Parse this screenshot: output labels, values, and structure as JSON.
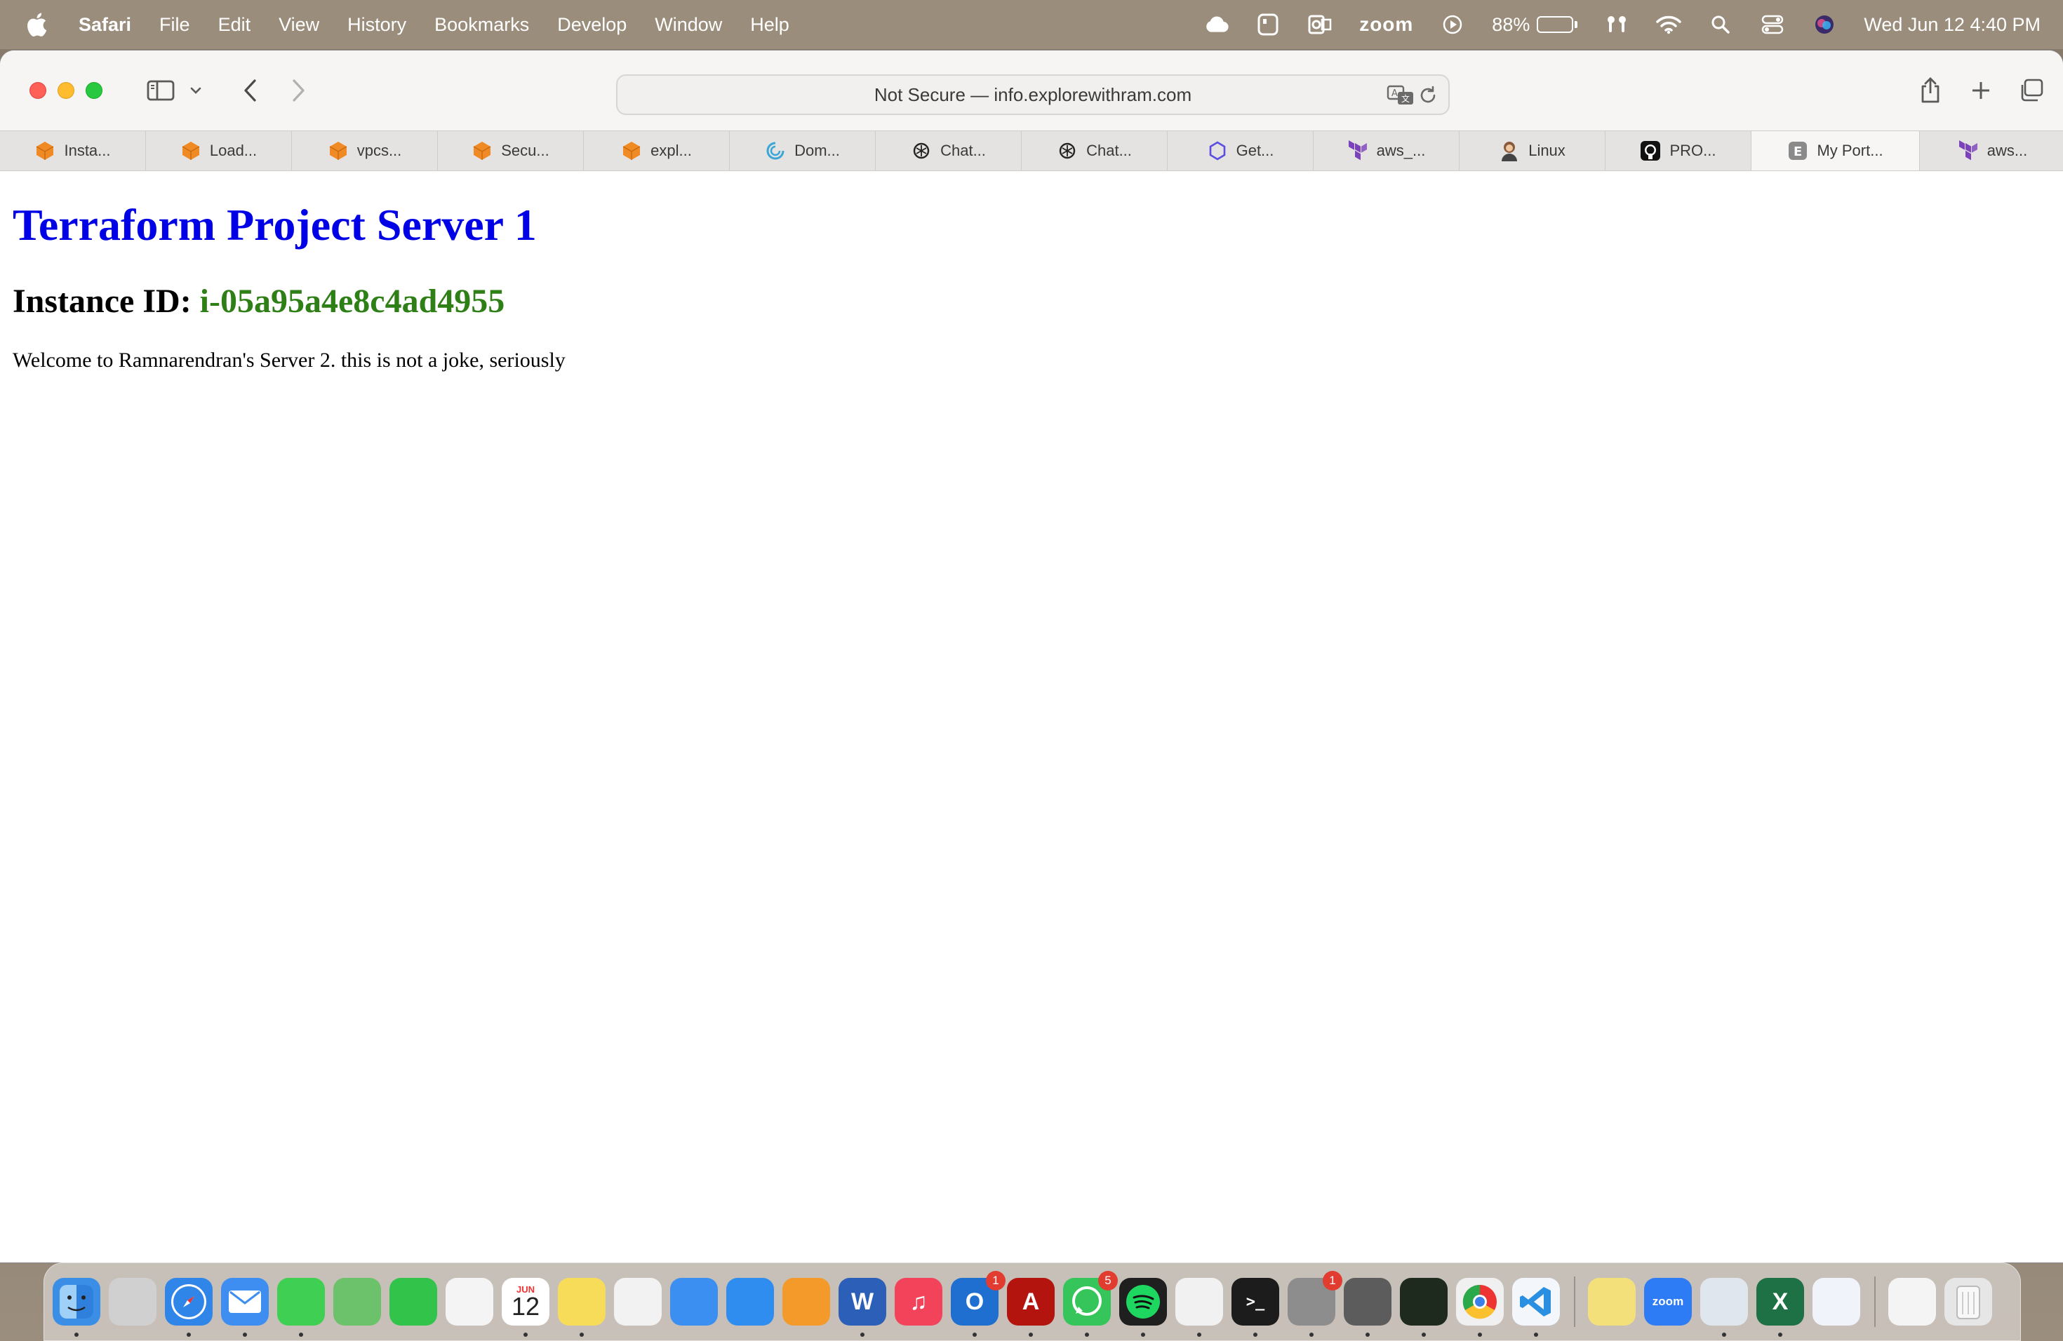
{
  "menubar": {
    "app_name": "Safari",
    "menus": [
      "File",
      "Edit",
      "View",
      "History",
      "Bookmarks",
      "Develop",
      "Window",
      "Help"
    ],
    "status": {
      "zoom_label": "zoom",
      "battery_percent": "88%",
      "battery_level": 0.88,
      "datetime": "Wed Jun 12  4:40 PM"
    }
  },
  "browser": {
    "address": {
      "text": "Not Secure — info.explorewithram.com"
    },
    "tabs": [
      {
        "label": "Insta...",
        "icon": "aws-cube-icon",
        "color": "#f08a24"
      },
      {
        "label": "Load...",
        "icon": "aws-cube-icon",
        "color": "#f08a24"
      },
      {
        "label": "vpcs...",
        "icon": "aws-cube-icon",
        "color": "#f08a24"
      },
      {
        "label": "Secu...",
        "icon": "aws-cube-icon",
        "color": "#f08a24"
      },
      {
        "label": "expl...",
        "icon": "aws-cube-icon",
        "color": "#f08a24"
      },
      {
        "label": "Dom...",
        "icon": "swirl-icon",
        "color": "#3aa6d8"
      },
      {
        "label": "Chat...",
        "icon": "chatgpt-icon",
        "color": "#222222"
      },
      {
        "label": "Chat...",
        "icon": "chatgpt-icon",
        "color": "#222222"
      },
      {
        "label": "Get...",
        "icon": "hexagon-icon",
        "color": "#5a4fe0"
      },
      {
        "label": "aws_...",
        "icon": "terraform-icon",
        "color": "#7b42bc"
      },
      {
        "label": "Linux",
        "icon": "avatar-icon",
        "color": "#8a5a3a"
      },
      {
        "label": "PRO...",
        "icon": "github-icon",
        "color": "#111111"
      },
      {
        "label": "My Port...",
        "icon": "letter-e-icon",
        "color": "#8a8a8a"
      },
      {
        "label": "aws...",
        "icon": "terraform-icon",
        "color": "#7b42bc"
      }
    ],
    "active_tab_index": 12
  },
  "page": {
    "heading": "Terraform Project Server 1",
    "instance_label": "Instance ID: ",
    "instance_id": "i-05a95a4e8c4ad4955",
    "message": "Welcome to Ramnarendran's Server 2. this is not a joke, seriously"
  },
  "dock": {
    "apps": [
      {
        "name": "finder",
        "color": "#3a8ee6",
        "badge": ""
      },
      {
        "name": "launchpad",
        "color": "#d0d0d0",
        "badge": ""
      },
      {
        "name": "safari",
        "color": "#2f86e8",
        "badge": ""
      },
      {
        "name": "mail",
        "color": "#3d8ef0",
        "badge": ""
      },
      {
        "name": "messages",
        "color": "#3fcf52",
        "badge": ""
      },
      {
        "name": "maps",
        "color": "#6cc26a",
        "badge": ""
      },
      {
        "name": "facetime",
        "color": "#32c34a",
        "badge": ""
      },
      {
        "name": "photos",
        "color": "#f4f4f4",
        "badge": ""
      },
      {
        "name": "calendar",
        "color": "#ffffff",
        "badge": ""
      },
      {
        "name": "notes",
        "color": "#f7dc5a",
        "badge": ""
      },
      {
        "name": "news",
        "color": "#f2f2f2",
        "badge": ""
      },
      {
        "name": "keynote",
        "color": "#3b8ff0",
        "badge": ""
      },
      {
        "name": "app-store",
        "color": "#2f8df0",
        "badge": ""
      },
      {
        "name": "pages",
        "color": "#f49a2a",
        "badge": ""
      },
      {
        "name": "word",
        "color": "#2b5fb8",
        "badge": ""
      },
      {
        "name": "music",
        "color": "#f3435a",
        "badge": ""
      },
      {
        "name": "outlook",
        "color": "#1f6fd1",
        "badge": "1"
      },
      {
        "name": "acrobat",
        "color": "#b3140d",
        "badge": ""
      },
      {
        "name": "whatsapp",
        "color": "#35c55a",
        "badge": "5"
      },
      {
        "name": "spotify",
        "color": "#1f1f1f",
        "badge": ""
      },
      {
        "name": "brave",
        "color": "#f1f1f1",
        "badge": ""
      },
      {
        "name": "terminal",
        "color": "#1c1c1c",
        "badge": ""
      },
      {
        "name": "system-settings",
        "color": "#8d8d8d",
        "badge": "1"
      },
      {
        "name": "calculator",
        "color": "#5c5c5c",
        "badge": ""
      },
      {
        "name": "activity-monitor",
        "color": "#1f2a1f",
        "badge": ""
      },
      {
        "name": "chrome",
        "color": "#f0f0f0",
        "badge": ""
      },
      {
        "name": "vscode",
        "color": "#f3f6fa",
        "badge": ""
      },
      {
        "name": "stickies",
        "color": "#f4e07a",
        "badge": ""
      },
      {
        "name": "zoom",
        "color": "#2d7cf6",
        "badge": ""
      },
      {
        "name": "preview",
        "color": "#dfe6ee",
        "badge": ""
      },
      {
        "name": "excel",
        "color": "#1e7145",
        "badge": ""
      },
      {
        "name": "onedrive",
        "color": "#f0f4fa",
        "badge": ""
      },
      {
        "name": "downloads-stack",
        "color": "#f4f4f4",
        "badge": ""
      },
      {
        "name": "trash",
        "color": "#e6e6e6",
        "badge": ""
      }
    ],
    "calendar_month": "JUN",
    "calendar_day": "12",
    "zoom_tile_label": "zoom"
  }
}
